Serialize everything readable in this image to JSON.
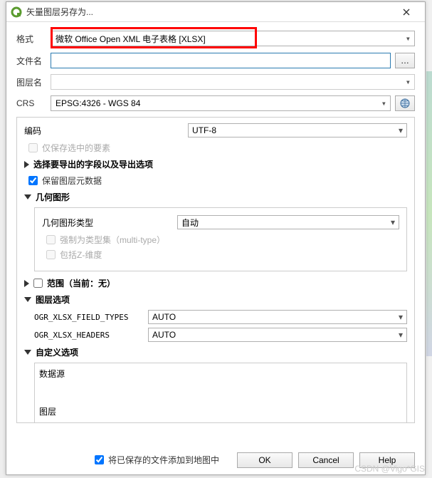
{
  "titlebar": {
    "title": "矢量图层另存为..."
  },
  "labels": {
    "format": "格式",
    "filename": "文件名",
    "layername": "图层名",
    "crs": "CRS"
  },
  "values": {
    "format": "微软 Office Open XML 电子表格 [XLSX]",
    "filename": "",
    "layername": "",
    "crs": "EPSG:4326 - WGS 84"
  },
  "browse_label": "…",
  "panel": {
    "encoding_label": "编码",
    "encoding_value": "UTF-8",
    "only_selected": "仅保存选中的要素",
    "fields_section": "选择要导出的字段以及导出选项",
    "keep_meta": "保留图层元数据",
    "geom_section": "几何图形",
    "geom_type_label": "几何图形类型",
    "geom_type_value": "自动",
    "force_multi": "强制为类型集（multi-type）",
    "include_z": "包括Z-维度",
    "extent_section": "范围（当前：无）",
    "layer_opts": "图层选项",
    "opt1_label": "OGR_XLSX_FIELD_TYPES",
    "opt1_value": "AUTO",
    "opt2_label": "OGR_XLSX_HEADERS",
    "opt2_value": "AUTO",
    "custom_opts": "自定义选项",
    "datasource": "数据源",
    "tuceng": "图层"
  },
  "footer": {
    "add_to_map": "将已保存的文件添加到地图中",
    "ok": "OK",
    "cancel": "Cancel",
    "help": "Help"
  },
  "watermark": "CSDN @Vigo*GIS"
}
